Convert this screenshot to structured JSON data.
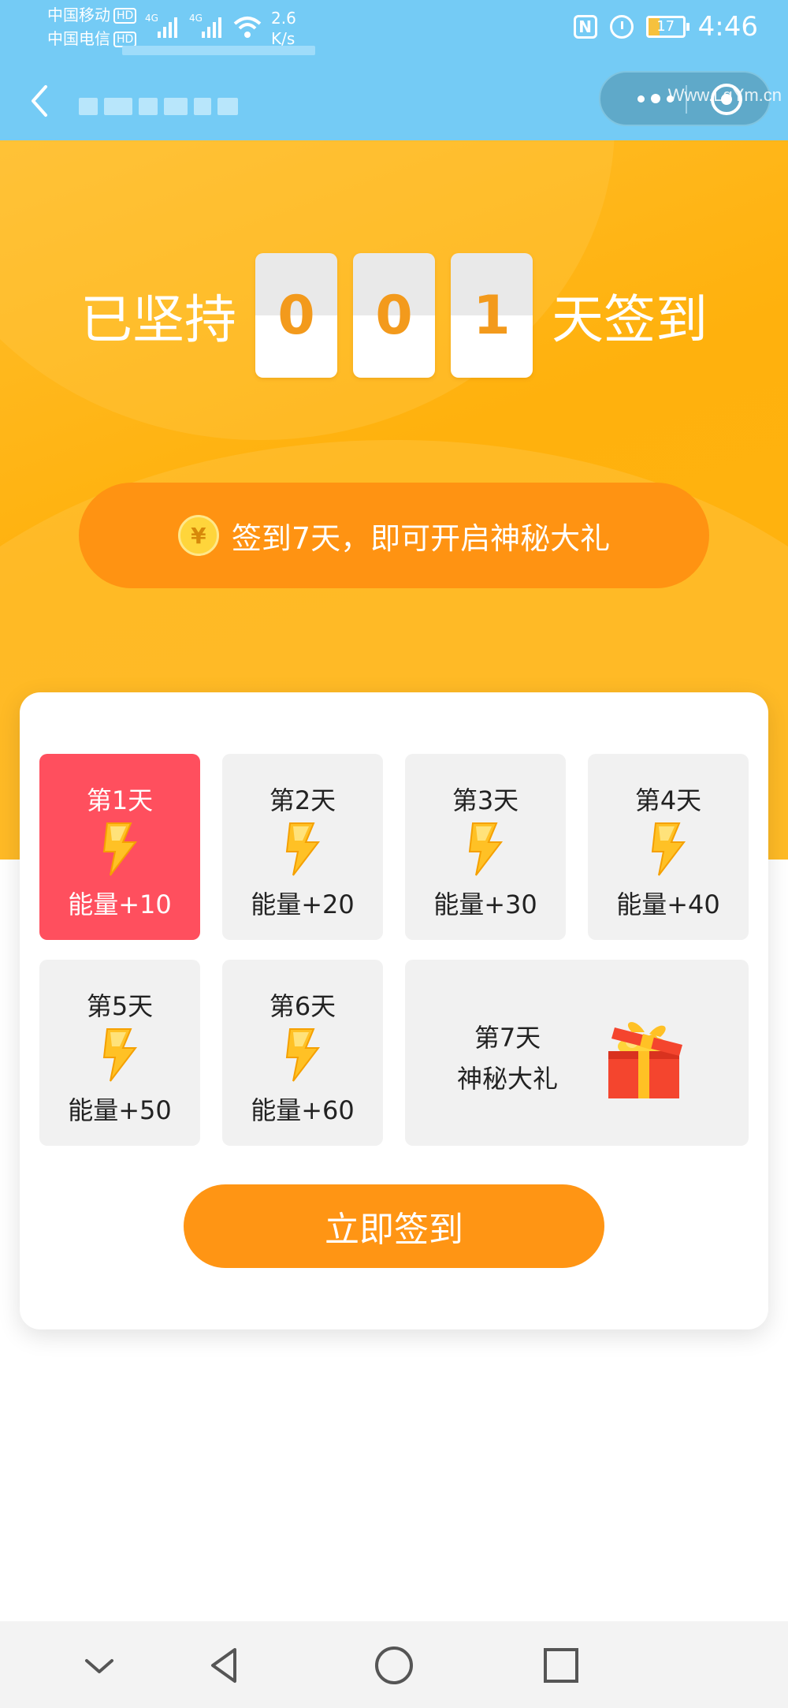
{
  "status_bar": {
    "carrier1": "中国移动",
    "carrier2": "中国电信",
    "hd": "HD",
    "network1": "4G",
    "network2": "4G",
    "speed_value": "2.6",
    "speed_unit": "K/s",
    "nfc": "N",
    "battery": "17",
    "time": "4:46"
  },
  "watermark": "Www.LgYm.cn",
  "streak": {
    "prefix": "已坚持",
    "digits": [
      "0",
      "0",
      "1"
    ],
    "suffix": "天签到"
  },
  "tip": {
    "coin_symbol": "¥",
    "text": "签到7天，即可开启神秘大礼"
  },
  "days": [
    {
      "label": "第1天",
      "reward": "能量+10"
    },
    {
      "label": "第2天",
      "reward": "能量+20"
    },
    {
      "label": "第3天",
      "reward": "能量+30"
    },
    {
      "label": "第4天",
      "reward": "能量+40"
    },
    {
      "label": "第5天",
      "reward": "能量+50"
    },
    {
      "label": "第6天",
      "reward": "能量+60"
    }
  ],
  "day7": {
    "label": "第7天",
    "name": "神秘大礼"
  },
  "sign_button": "立即签到",
  "colors": {
    "accent_orange": "#ff9514",
    "active_day": "#ff4f5e",
    "header_blue": "#74cbf5"
  }
}
